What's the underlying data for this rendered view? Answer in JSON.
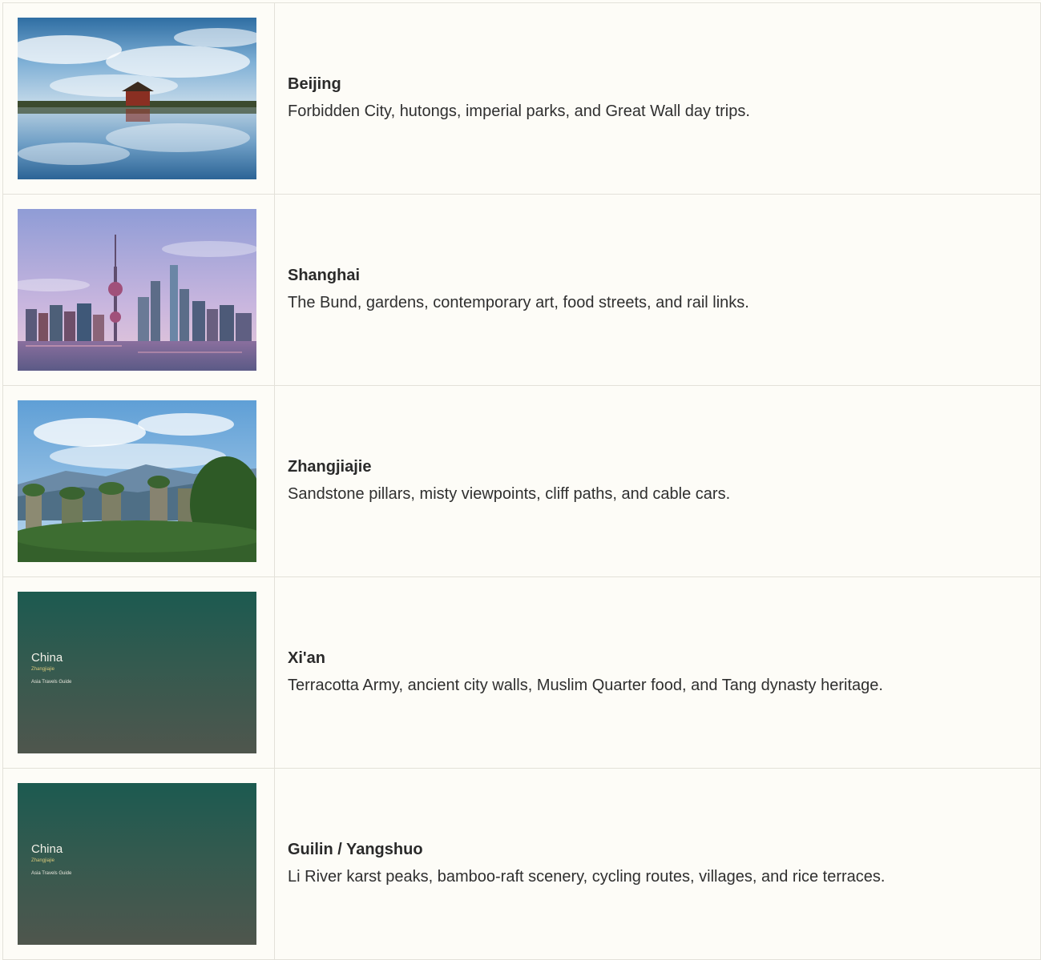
{
  "destinations": [
    {
      "name": "Beijing",
      "description": "Forbidden City, hutongs, imperial parks, and Great Wall day trips.",
      "image": "forbidden-city-reflection-photo"
    },
    {
      "name": "Shanghai",
      "description": "The Bund, gardens, contemporary art, food streets, and rail links.",
      "image": "shanghai-skyline-photo"
    },
    {
      "name": "Zhangjiajie",
      "description": "Sandstone pillars, misty viewpoints, cliff paths, and cable cars.",
      "image": "zhangjiajie-pillars-photo"
    },
    {
      "name": "Xi'an",
      "description": "Terracotta Army, ancient city walls, Muslim Quarter food, and Tang dynasty heritage.",
      "image": "placeholder-card",
      "placeholder": {
        "title": "China",
        "subtitle": "Zhangjiajie",
        "guide": "Asia Travels Guide"
      }
    },
    {
      "name": "Guilin / Yangshuo",
      "description": "Li River karst peaks, bamboo-raft scenery, cycling routes, villages, and rice terraces.",
      "image": "placeholder-card",
      "placeholder": {
        "title": "China",
        "subtitle": "Zhangjiajie",
        "guide": "Asia Travels Guide"
      }
    }
  ],
  "colors": {
    "background": "#fdfcf7",
    "border": "#e3e1d9",
    "placeholder_top": "#1c5a50",
    "placeholder_bottom": "#4f564d",
    "placeholder_subtitle": "#d8c87a"
  }
}
